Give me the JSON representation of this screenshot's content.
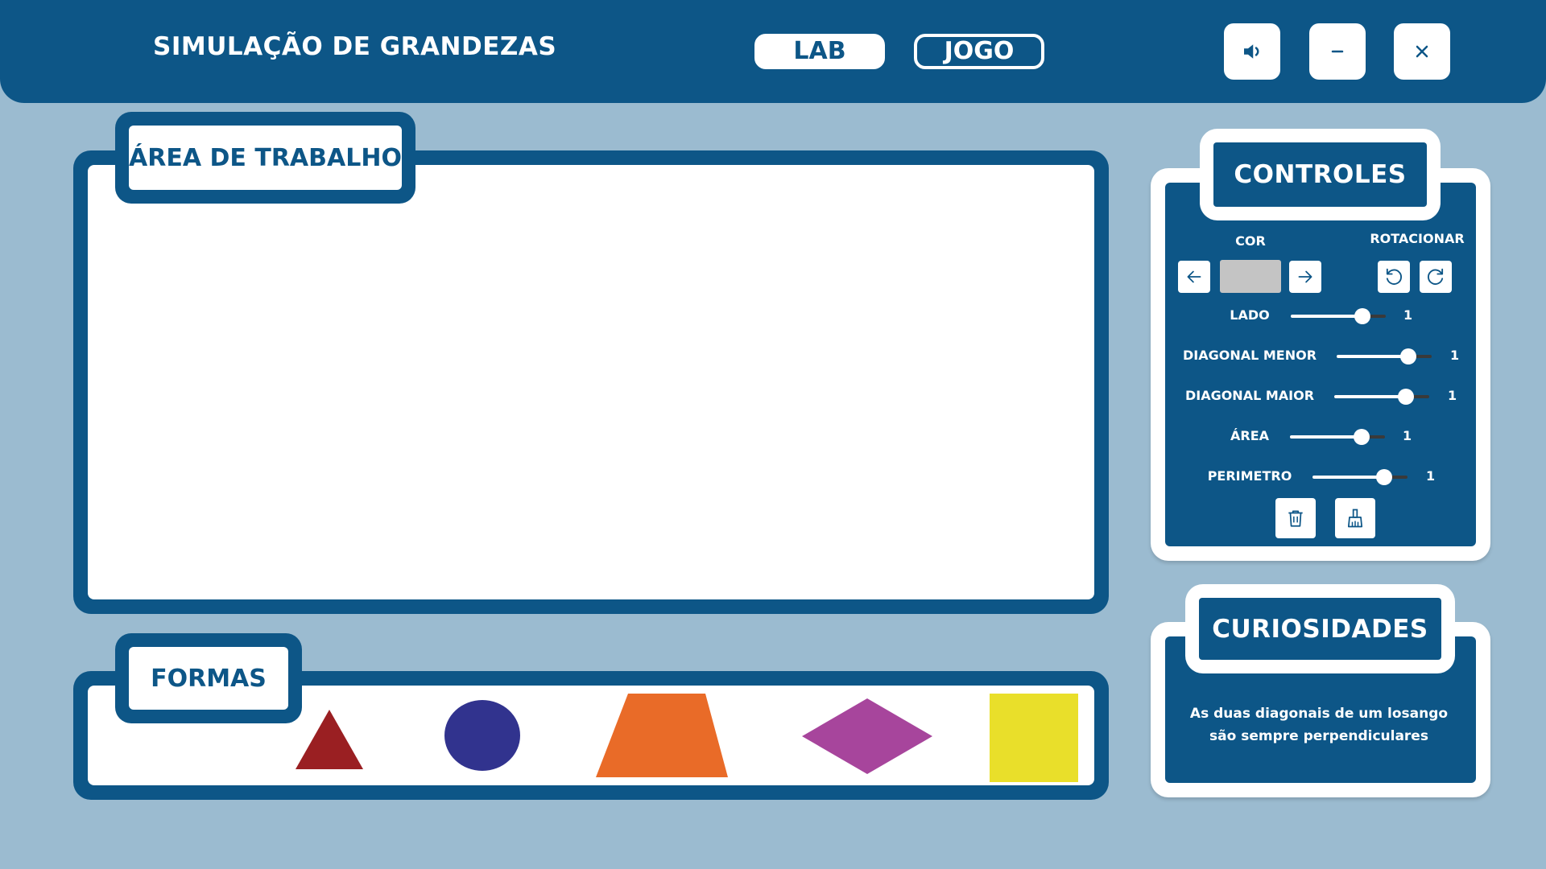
{
  "header": {
    "title": "SIMULAÇÃO DE GRANDEZAS",
    "modes": [
      "LAB",
      "JOGO"
    ],
    "active_mode": "LAB",
    "window_controls": [
      "speaker-icon",
      "minimize-icon",
      "close-icon"
    ]
  },
  "workspace": {
    "title": "ÁREA DE TRABALHO"
  },
  "shapes_panel": {
    "title": "FORMAS",
    "shapes": [
      {
        "name": "triangle",
        "color": "#9a1f22"
      },
      {
        "name": "circle",
        "color": "#31338e"
      },
      {
        "name": "trapezoid",
        "color": "#e96b28"
      },
      {
        "name": "rhombus",
        "color": "#a7459c"
      },
      {
        "name": "square",
        "color": "#e9df2a"
      }
    ]
  },
  "controls": {
    "title": "CONTROLES",
    "color_label": "COR",
    "rotate_label": "ROTACIONAR",
    "current_color": "#c4c4c4",
    "sliders": [
      {
        "label": "LADO",
        "value": "1",
        "level": 0.75
      },
      {
        "label": "DIAGONAL MENOR",
        "value": "1",
        "level": 0.75
      },
      {
        "label": "DIAGONAL MAIOR",
        "value": "1",
        "level": 0.75
      },
      {
        "label": "ÁREA",
        "value": "1",
        "level": 0.75
      },
      {
        "label": "PERIMETRO",
        "value": "1",
        "level": 0.75
      }
    ],
    "buttons": [
      "arrow-left-icon",
      "arrow-right-icon",
      "rotate-left-icon",
      "rotate-right-icon",
      "trash-icon",
      "brush-icon"
    ]
  },
  "curiosities": {
    "title": "CURIOSIDADES",
    "line1": "As duas diagonais de um losango",
    "line2": "são sempre perpendiculares"
  },
  "colors": {
    "primary": "#0d5687",
    "background": "#9bbbd0",
    "white": "#ffffff"
  }
}
